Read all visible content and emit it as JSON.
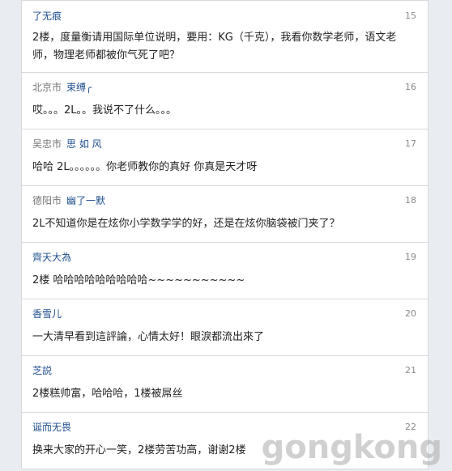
{
  "comments": [
    {
      "location": "",
      "user": "了无痕",
      "floor": "15",
      "text": "2楼，度量衡请用国际单位说明，要用：KG（千克），我看你数学老师，语文老师，物理老师都被你气死了吧？"
    },
    {
      "location": "北京市",
      "user": "束缚╭",
      "floor": "16",
      "text": "哎。。。2L。。我说不了什么。。。"
    },
    {
      "location": "吴忠市",
      "user": "思 如 风",
      "floor": "17",
      "text": "哈哈 2L。。。。。。你老师教你的真好 你真是天才呀"
    },
    {
      "location": "德阳市",
      "user": "幽了一默",
      "floor": "18",
      "text": "2L不知道你是在炫你小学数学学的好，还是在炫你脑袋被门夹了？"
    },
    {
      "location": "",
      "user": "齊天大為",
      "floor": "19",
      "text": "2楼 哈哈哈哈哈哈哈哈哈~~~~~~~~~~~"
    },
    {
      "location": "",
      "user": "香雪儿",
      "floor": "20",
      "text": "一大清早看到這評論，心情太好！眼淚都流出來了"
    },
    {
      "location": "",
      "user": "芝説",
      "floor": "21",
      "text": "2楼糕帅富，哈哈哈，1楼被屌丝"
    },
    {
      "location": "",
      "user": "诞而无畏",
      "floor": "22",
      "text": "换来大家的开心一笑，2楼劳苦功高，谢谢2楼"
    }
  ],
  "watermark": "gongkong"
}
